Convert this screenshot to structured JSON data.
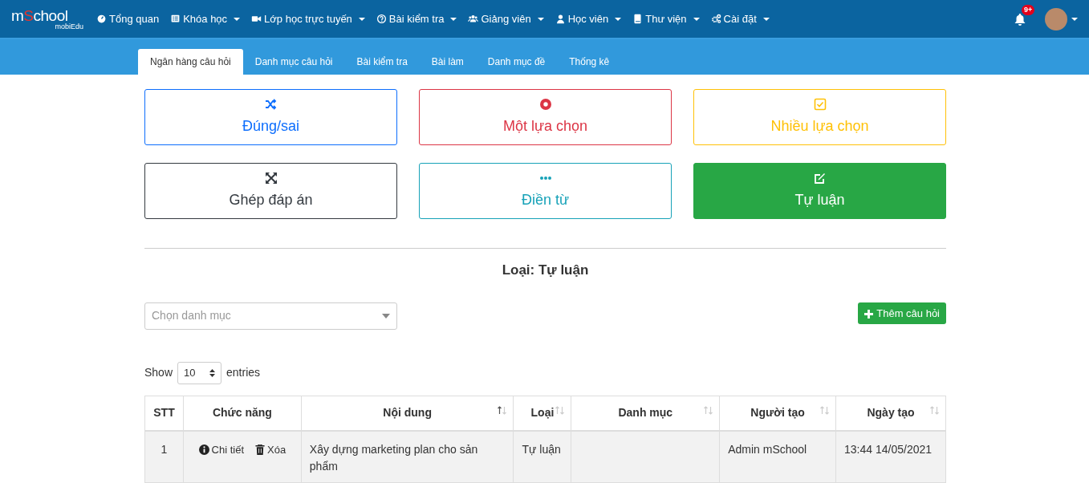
{
  "logo": {
    "before": "m",
    "accent": "S",
    "after": "chool",
    "sub": "mobiEdu"
  },
  "menu": [
    {
      "label": "Tổng quan",
      "dropdown": false
    },
    {
      "label": "Khóa học",
      "dropdown": true
    },
    {
      "label": "Lớp học trực tuyến",
      "dropdown": true
    },
    {
      "label": "Bài kiểm tra",
      "dropdown": true
    },
    {
      "label": "Giảng viên",
      "dropdown": true
    },
    {
      "label": "Học viên",
      "dropdown": true
    },
    {
      "label": "Thư viện",
      "dropdown": true
    },
    {
      "label": "Cài đặt",
      "dropdown": true
    }
  ],
  "notifications": {
    "badge": "9+"
  },
  "tabs": [
    {
      "label": "Ngân hàng câu hỏi",
      "selected": true
    },
    {
      "label": "Danh mục câu hỏi",
      "selected": false
    },
    {
      "label": "Bài kiểm tra",
      "selected": false
    },
    {
      "label": "Bài làm",
      "selected": false
    },
    {
      "label": "Danh mục đề",
      "selected": false
    },
    {
      "label": "Thống kê",
      "selected": false
    }
  ],
  "question_types": [
    {
      "label": "Đúng/sai",
      "color": "#0d6efd",
      "selected": false
    },
    {
      "label": "Một lựa chọn",
      "color": "#dc3545",
      "selected": false
    },
    {
      "label": "Nhiều lựa chọn",
      "color": "#ffc107",
      "selected": false
    },
    {
      "label": "Ghép đáp án",
      "color": "#343a40",
      "selected": false
    },
    {
      "label": "Điền từ",
      "color": "#17a2b8",
      "selected": false
    },
    {
      "label": "Tự luận",
      "color": "#28a745",
      "selected": true
    }
  ],
  "type_heading": "Loại: Tự luận",
  "category_select": {
    "placeholder": "Chọn danh mục"
  },
  "add_button": "Thêm câu hỏi",
  "entries": {
    "show": "Show",
    "value": "10",
    "suffix": "entries"
  },
  "table": {
    "columns": [
      {
        "label": "STT",
        "sortable": false
      },
      {
        "label": "Chức năng",
        "sortable": false
      },
      {
        "label": "Nội dung",
        "sortable": true,
        "sorted_ascending": true
      },
      {
        "label": "Loại",
        "sortable": true,
        "sorted_ascending": false
      },
      {
        "label": "Danh mục",
        "sortable": true,
        "sorted_ascending": false
      },
      {
        "label": "Người tạo",
        "sortable": true,
        "sorted_ascending": false
      },
      {
        "label": "Ngày tạo",
        "sortable": true,
        "sorted_ascending": false
      }
    ],
    "rows": [
      {
        "stt": "1",
        "actions": [
          "Chi tiết",
          "Xóa"
        ],
        "content": "Xây dựng marketing plan cho sản phẩm",
        "type": "Tự luận",
        "category": "",
        "creator": "Admin mSchool",
        "created": "13:44 14/05/2021"
      }
    ]
  }
}
